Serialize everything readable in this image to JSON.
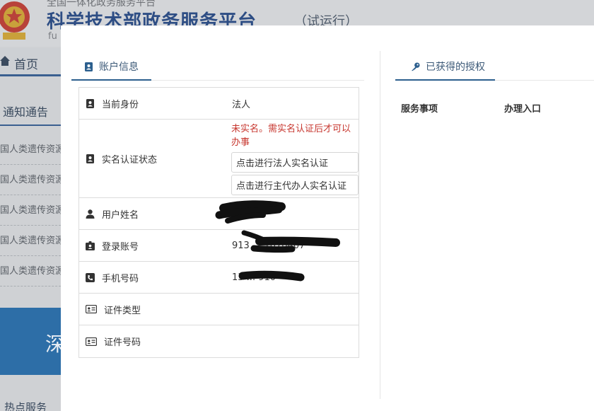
{
  "background": {
    "top_text": "全国一体化政务服务平台",
    "title": "科学技术部政务服务平台",
    "title_suffix": "（试运行）",
    "small_text": "fu",
    "nav_home": "首页",
    "notice_title": "通知通告",
    "notice_items": [
      "国人类遗传资源",
      "国人类遗传资源",
      "国人类遗传资源",
      "国人类遗传资源",
      "国人类遗传资源"
    ],
    "banner_text": "深",
    "hot_service": "热点服务"
  },
  "account": {
    "tab_label": "账户信息",
    "rows": {
      "identity": {
        "label": "当前身份",
        "value": "法人"
      },
      "verify": {
        "label": "实名认证状态",
        "status": "未实名。需实名认证后才可以办事",
        "btn_legal": "点击进行法人实名认证",
        "btn_agent": "点击进行主代办人实名认证"
      },
      "username": {
        "label": "用户姓名",
        "value": ""
      },
      "login": {
        "label": "登录账号",
        "value": "913 ... 1070407"
      },
      "phone": {
        "label": "手机号码",
        "value": "13 ... 910"
      },
      "cert_type": {
        "label": "证件类型",
        "value": ""
      },
      "cert_no": {
        "label": "证件号码",
        "value": ""
      }
    }
  },
  "authorization": {
    "tab_label": "已获得的授权",
    "col_service": "服务事项",
    "col_entry": "办理入口"
  },
  "colors": {
    "accent": "#2c5f8e",
    "warning_text": "#c7362e",
    "overlay_bg": "#cfd1d4"
  },
  "icons": {
    "account_tab": "contact-book-icon",
    "auth_tab": "key-icon",
    "identity": "id-badge-icon",
    "verify": "id-badge-icon",
    "username": "user-icon",
    "login": "badge-icon",
    "phone": "phone-icon",
    "cert_type": "id-card-icon",
    "cert_no": "id-card-icon"
  }
}
